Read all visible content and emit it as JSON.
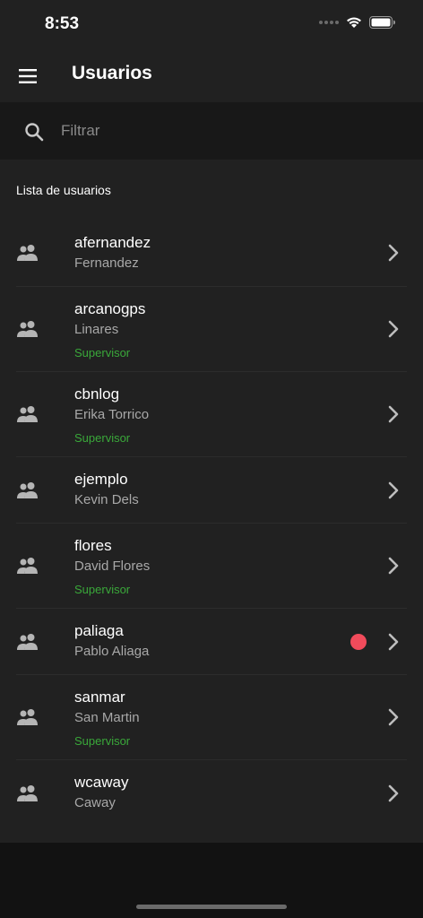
{
  "status_bar": {
    "time": "8:53"
  },
  "app_bar": {
    "title": "Usuarios",
    "menu_icon": "menu-icon"
  },
  "search": {
    "placeholder": "Filtrar",
    "value": ""
  },
  "section": {
    "header": "Lista de usuarios"
  },
  "users": [
    {
      "username": "afernandez",
      "fullname": "Fernandez",
      "role": ""
    },
    {
      "username": "arcanogps",
      "fullname": "Linares",
      "role": "Supervisor"
    },
    {
      "username": "cbnlog",
      "fullname": "Erika Torrico",
      "role": "Supervisor"
    },
    {
      "username": "ejemplo",
      "fullname": "Kevin Dels",
      "role": ""
    },
    {
      "username": "flores",
      "fullname": "David Flores",
      "role": "Supervisor"
    },
    {
      "username": "paliaga",
      "fullname": "Pablo Aliaga",
      "role": "",
      "online_indicator": true
    },
    {
      "username": "sanmar",
      "fullname": "San Martin",
      "role": "Supervisor"
    },
    {
      "username": "wcaway",
      "fullname": "Caway",
      "role": ""
    }
  ],
  "colors": {
    "background": "#121212",
    "surface": "#212121",
    "role_green": "#3aa83a",
    "indicator_red": "#f14b5b"
  }
}
